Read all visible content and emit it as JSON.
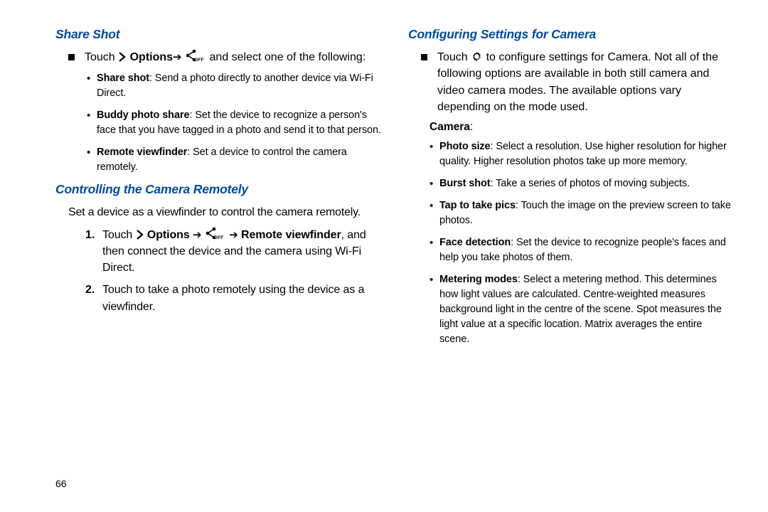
{
  "left": {
    "heading_share": "Share Shot",
    "touch": "Touch ",
    "options_bold": "Options",
    "and_select": " and select one of the following:",
    "share_shot_b": "Share shot",
    "share_shot_t": ": Send a photo directly to another device via Wi-Fi Direct.",
    "buddy_b": "Buddy photo share",
    "buddy_t": ": Set the device to recognize a person's face that you have tagged in a photo and send it to that person.",
    "remote_vf_b": "Remote viewfinder",
    "remote_vf_t": ": Set a device to control the camera remotely.",
    "heading_ctrl": "Controlling the Camera Remotely",
    "ctrl_intro": "Set a device as a viewfinder to control the camera remotely.",
    "step1_a": "Touch ",
    "step1_opts": " Options ",
    "step1_rvf": " Remote viewfinder",
    "step1_tail": ", and then connect the device and the camera using Wi-Fi Direct.",
    "step2": "Touch to take a photo remotely using the device as a viewfinder."
  },
  "right": {
    "heading": "Configuring Settings for Camera",
    "touch": "Touch ",
    "intro_tail": " to configure settings for Camera. Not all of the following options are available in both still camera and video camera modes. The available options vary depending on the mode used.",
    "camera_label_b": "Camera",
    "camera_label_t": ":",
    "b1b": "Photo size",
    "b1t": ": Select a resolution. Use higher resolution for higher quality. Higher resolution photos take up more memory.",
    "b2b": "Burst shot",
    "b2t": ": Take a series of photos of moving subjects.",
    "b3b": "Tap to take pics",
    "b3t": ": Touch the image on the preview screen to take photos.",
    "b4b": "Face detection",
    "b4t": ": Set the device to recognize people's faces and help you take photos of them.",
    "b5b": "Metering modes",
    "b5t": ": Select a metering method. This determines how light values are calculated. Centre-weighted measures background light in the centre of the scene. Spot measures the light value at a specific location. Matrix averages the entire scene."
  },
  "page_number": "66",
  "icons": {
    "off_label": "OFF"
  }
}
